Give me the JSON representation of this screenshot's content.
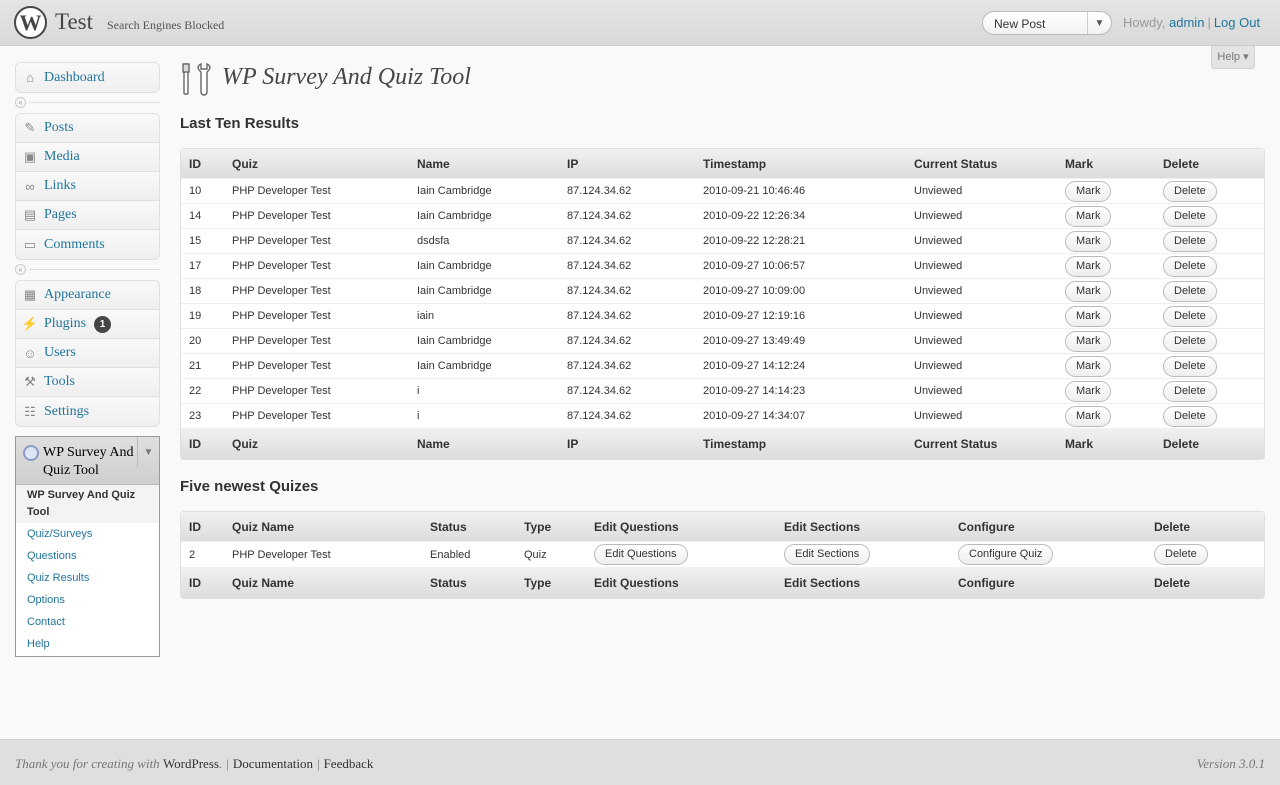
{
  "header": {
    "site_title": "Test",
    "site_status": "Search Engines Blocked",
    "new_post": "New Post",
    "howdy": "Howdy,",
    "user": "admin",
    "logout": "Log Out"
  },
  "help_tab": "Help",
  "menu": {
    "dashboard": "Dashboard",
    "posts": "Posts",
    "media": "Media",
    "links": "Links",
    "pages": "Pages",
    "comments": "Comments",
    "appearance": "Appearance",
    "plugins": "Plugins",
    "plugins_badge": "1",
    "users": "Users",
    "tools": "Tools",
    "settings": "Settings",
    "plugin_title": "WP Survey And Quiz Tool",
    "submenu": [
      "WP Survey And Quiz Tool",
      "Quiz/Surveys",
      "Questions",
      "Quiz Results",
      "Options",
      "Contact",
      "Help"
    ]
  },
  "page_title": "WP Survey And Quiz Tool",
  "results": {
    "title": "Last Ten Results",
    "columns": [
      "ID",
      "Quiz",
      "Name",
      "IP",
      "Timestamp",
      "Current Status",
      "Mark",
      "Delete"
    ],
    "mark_label": "Mark",
    "delete_label": "Delete",
    "rows": [
      {
        "id": "10",
        "quiz": "PHP Developer Test",
        "name": "Iain Cambridge",
        "ip": "87.124.34.62",
        "timestamp": "2010-09-21 10:46:46",
        "status": "Unviewed"
      },
      {
        "id": "14",
        "quiz": "PHP Developer Test",
        "name": "Iain Cambridge",
        "ip": "87.124.34.62",
        "timestamp": "2010-09-22 12:26:34",
        "status": "Unviewed"
      },
      {
        "id": "15",
        "quiz": "PHP Developer Test",
        "name": "dsdsfa",
        "ip": "87.124.34.62",
        "timestamp": "2010-09-22 12:28:21",
        "status": "Unviewed"
      },
      {
        "id": "17",
        "quiz": "PHP Developer Test",
        "name": "Iain Cambridge",
        "ip": "87.124.34.62",
        "timestamp": "2010-09-27 10:06:57",
        "status": "Unviewed"
      },
      {
        "id": "18",
        "quiz": "PHP Developer Test",
        "name": "Iain Cambridge",
        "ip": "87.124.34.62",
        "timestamp": "2010-09-27 10:09:00",
        "status": "Unviewed"
      },
      {
        "id": "19",
        "quiz": "PHP Developer Test",
        "name": "iain",
        "ip": "87.124.34.62",
        "timestamp": "2010-09-27 12:19:16",
        "status": "Unviewed"
      },
      {
        "id": "20",
        "quiz": "PHP Developer Test",
        "name": "Iain Cambridge",
        "ip": "87.124.34.62",
        "timestamp": "2010-09-27 13:49:49",
        "status": "Unviewed"
      },
      {
        "id": "21",
        "quiz": "PHP Developer Test",
        "name": "Iain Cambridge",
        "ip": "87.124.34.62",
        "timestamp": "2010-09-27 14:12:24",
        "status": "Unviewed"
      },
      {
        "id": "22",
        "quiz": "PHP Developer Test",
        "name": "i",
        "ip": "87.124.34.62",
        "timestamp": "2010-09-27 14:14:23",
        "status": "Unviewed"
      },
      {
        "id": "23",
        "quiz": "PHP Developer Test",
        "name": "i",
        "ip": "87.124.34.62",
        "timestamp": "2010-09-27 14:34:07",
        "status": "Unviewed"
      }
    ]
  },
  "quizzes": {
    "title": "Five newest Quizes",
    "columns": [
      "ID",
      "Quiz Name",
      "Status",
      "Type",
      "Edit Questions",
      "Edit Sections",
      "Configure",
      "Delete"
    ],
    "rows": [
      {
        "id": "2",
        "name": "PHP Developer Test",
        "status": "Enabled",
        "type": "Quiz",
        "edit_questions": "Edit Questions",
        "edit_sections": "Edit Sections",
        "configure": "Configure Quiz",
        "delete": "Delete"
      }
    ]
  },
  "footer": {
    "thanks": "Thank you for creating with",
    "wordpress": "WordPress",
    "documentation": "Documentation",
    "feedback": "Feedback",
    "version": "Version 3.0.1"
  }
}
